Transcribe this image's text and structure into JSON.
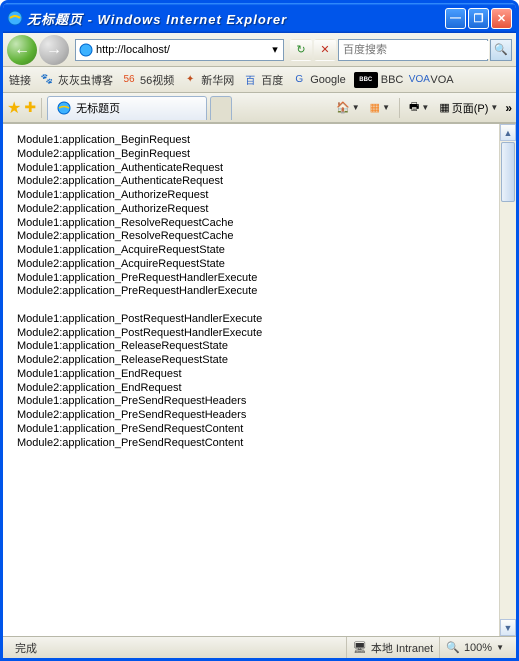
{
  "title": "无标题页 - Windows Internet Explorer",
  "nav": {
    "back": "←",
    "fwd": "→"
  },
  "address": {
    "url": "http://localhost/",
    "dd": "▾"
  },
  "refresh": "↻",
  "stop": "✕",
  "search": {
    "placeholder": "百度搜索",
    "icon": "🔍"
  },
  "links_label": "链接",
  "favs": [
    {
      "ico": "🐾",
      "label": "灰灰虫博客",
      "c": "#3a7fd5"
    },
    {
      "ico": "56",
      "label": "56视频",
      "c": "#e04b1a"
    },
    {
      "ico": "✦",
      "label": "新华网",
      "c": "#c05020"
    },
    {
      "ico": "百",
      "label": "百度",
      "c": "#2a62c8"
    },
    {
      "ico": "G",
      "label": "Google",
      "c": "#2a62c8"
    },
    {
      "ico": "BBC",
      "label": "BBC",
      "c": "#000"
    },
    {
      "ico": "VOA",
      "label": "VOA",
      "c": "#2a62c8"
    }
  ],
  "tab": {
    "label": "无标题页"
  },
  "rt": {
    "home": "🏠",
    "feed": "▦",
    "print": "🖶",
    "page": "页面(P)",
    "chev": "»"
  },
  "body_lines": [
    "Module1:application_BeginRequest",
    "Module2:application_BeginRequest",
    "Module1:application_AuthenticateRequest",
    "Module2:application_AuthenticateRequest",
    "Module1:application_AuthorizeRequest",
    "Module2:application_AuthorizeRequest",
    "Module1:application_ResolveRequestCache",
    "Module2:application_ResolveRequestCache",
    "Module1:application_AcquireRequestState",
    "Module2:application_AcquireRequestState",
    "Module1:application_PreRequestHandlerExecute",
    "Module2:application_PreRequestHandlerExecute",
    "",
    "Module1:application_PostRequestHandlerExecute",
    "Module2:application_PostRequestHandlerExecute",
    "Module1:application_ReleaseRequestState",
    "Module2:application_ReleaseRequestState",
    "Module1:application_EndRequest",
    "Module2:application_EndRequest",
    "Module1:application_PreSendRequestHeaders",
    "Module2:application_PreSendRequestHeaders",
    "Module1:application_PreSendRequestContent",
    "Module2:application_PreSendRequestContent"
  ],
  "status": {
    "done": "完成",
    "zone": "本地 Intranet",
    "zoom": "100%",
    "zone_ico": "🖥",
    "zoom_ico": "🔍"
  }
}
